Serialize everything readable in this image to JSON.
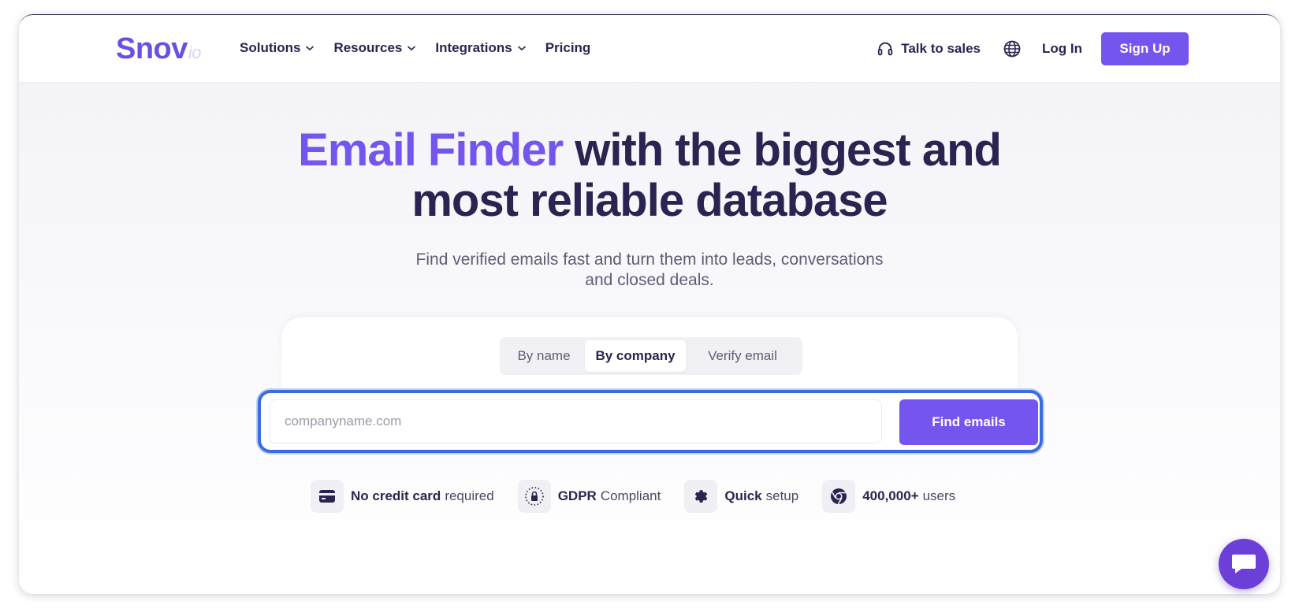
{
  "brand": {
    "logo_main": "Snov",
    "logo_suffix": "io"
  },
  "nav": {
    "items": [
      {
        "label": "Solutions",
        "has_dropdown": true
      },
      {
        "label": "Resources",
        "has_dropdown": true
      },
      {
        "label": "Integrations",
        "has_dropdown": true
      },
      {
        "label": "Pricing",
        "has_dropdown": false
      }
    ],
    "talk_to_sales": "Talk to sales",
    "login": "Log In",
    "signup": "Sign Up"
  },
  "hero": {
    "title_accent": "Email Finder",
    "title_rest_1": " with the biggest and",
    "title_rest_2": "most reliable database",
    "subtitle_line1": "Find verified emails fast and turn them into leads, conversations",
    "subtitle_line2": "and closed deals."
  },
  "search": {
    "tabs": [
      {
        "label": "By name",
        "active": false
      },
      {
        "label": "By company",
        "active": true
      },
      {
        "label": "Verify email",
        "active": false
      }
    ],
    "placeholder": "companyname.com",
    "value": "",
    "button": "Find emails"
  },
  "features": [
    {
      "icon": "credit-card-icon",
      "bold": "No credit card",
      "rest": "required"
    },
    {
      "icon": "lock-icon",
      "bold": "GDPR",
      "rest": "Compliant"
    },
    {
      "icon": "gear-icon",
      "bold": "Quick",
      "rest": "setup"
    },
    {
      "icon": "chrome-icon",
      "bold": "400,000+",
      "rest": "users"
    }
  ],
  "colors": {
    "accent": "#7456ef",
    "text_dark": "#2a2550",
    "focus_ring": "#3d6be0",
    "chat_bubble": "#6b3fd8"
  }
}
